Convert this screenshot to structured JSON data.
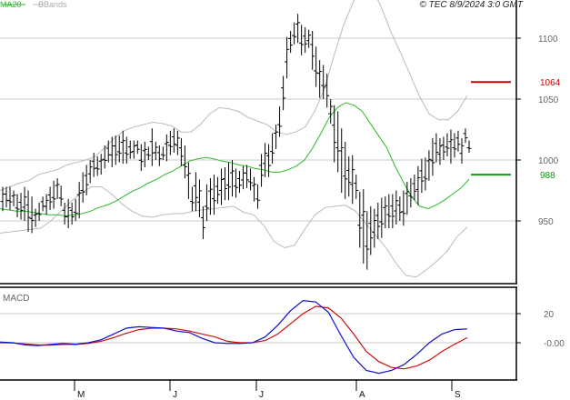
{
  "chart_data": [
    {
      "type": "line",
      "panel": "price",
      "header": "© TEC 8/9/2024 3:0 GMT",
      "legend": [
        {
          "name": "MA20",
          "color": "#2db82d"
        },
        {
          "name": "BBands",
          "color": "#bbbbbb"
        }
      ],
      "y_ticks": [
        950,
        1000,
        1050,
        1100
      ],
      "ylim": [
        900,
        1120
      ],
      "x_ticks": [
        "M",
        "J",
        "J",
        "A",
        "S"
      ],
      "annotations": [
        {
          "label": "1064",
          "value": 1064,
          "color": "#cc0000"
        },
        {
          "label": "988",
          "value": 988,
          "color": "#129912"
        }
      ],
      "series": [
        {
          "name": "Price (OHLC bars)",
          "color": "#000000",
          "highs": [
            978,
            978,
            978,
            975,
            972,
            973,
            978,
            975,
            970,
            960,
            965,
            970,
            972,
            978,
            983,
            985,
            979,
            965,
            968,
            965,
            968,
            982,
            990,
            996,
            1000,
            1006,
            1003,
            1005,
            1012,
            1016,
            1019,
            1020,
            1020,
            1024,
            1019,
            1016,
            1016,
            1016,
            1013,
            1015,
            1011,
            1026,
            1015,
            1012,
            1011,
            1021,
            1024,
            1026,
            1024,
            1018,
            1012,
            998,
            978,
            990,
            984,
            962,
            980,
            985,
            988,
            986,
            993,
            994,
            998,
            1000,
            993,
            991,
            995,
            996,
            993,
            986,
            980,
            1005,
            1014,
            1013,
            1022,
            1029,
            1044,
            1069,
            1101,
            1106,
            1113,
            1120,
            1111,
            1109,
            1107,
            1106,
            1093,
            1082,
            1078,
            1071,
            1050,
            1045,
            1040,
            1026,
            1015,
            1003,
            1004,
            988,
            974,
            976,
            958,
            962,
            960,
            965,
            969,
            970,
            972,
            972,
            975,
            970,
            975,
            982,
            985,
            988,
            995,
            1001,
            1002,
            1008,
            1018,
            1022,
            1018,
            1019,
            1022,
            1025,
            1022,
            1024,
            1018,
            1026,
            1016
          ],
          "lows": [
            958,
            961,
            959,
            962,
            953,
            951,
            950,
            941,
            940,
            945,
            950,
            958,
            955,
            959,
            960,
            968,
            962,
            947,
            944,
            947,
            950,
            952,
            965,
            971,
            981,
            986,
            987,
            988,
            993,
            998,
            994,
            996,
            998,
            997,
            997,
            1001,
            1001,
            1005,
            991,
            994,
            1000,
            995,
            1000,
            995,
            1000,
            999,
            1004,
            1006,
            1004,
            995,
            985,
            968,
            958,
            958,
            953,
            935,
            950,
            955,
            955,
            964,
            963,
            967,
            967,
            970,
            969,
            973,
            976,
            977,
            975,
            966,
            960,
            978,
            986,
            986,
            997,
            1009,
            1019,
            1041,
            1067,
            1088,
            1095,
            1096,
            1086,
            1088,
            1092,
            1074,
            1060,
            1051,
            1050,
            1043,
            1030,
            998,
            990,
            973,
            968,
            970,
            964,
            968,
            928,
            915,
            910,
            922,
            928,
            935,
            936,
            944,
            944,
            944,
            947,
            950,
            946,
            955,
            961,
            967,
            963,
            973,
            975,
            983,
            987,
            998,
            996,
            1000,
            1003,
            997,
            1002,
            1007,
            997,
            1014,
            1006
          ]
        },
        {
          "name": "MA20",
          "color": "#2db82d",
          "values": [
            960,
            959,
            958,
            958,
            957,
            956,
            955,
            955,
            954,
            955,
            956,
            958,
            961,
            963,
            966,
            970,
            974,
            977,
            981,
            984,
            988,
            991,
            995,
            999,
            1001,
            1002,
            1001,
            999,
            998,
            996,
            995,
            993,
            992,
            990,
            990,
            992,
            995,
            1000,
            1010,
            1022,
            1035,
            1043,
            1047,
            1045,
            1040,
            1030,
            1020,
            1010,
            995,
            982,
            970,
            962,
            960,
            963,
            967,
            972,
            977,
            984
          ]
        },
        {
          "name": "BB upper",
          "color": "#bbbbbb",
          "values": [
            975,
            978,
            981,
            983,
            988,
            990,
            992,
            996,
            998,
            1000,
            1003,
            1010,
            1018,
            1024,
            1027,
            1029,
            1031,
            1030,
            1028,
            1023,
            1023,
            1029,
            1038,
            1043,
            1042,
            1040,
            1035,
            1032,
            1029,
            1023,
            1021,
            1023,
            1027,
            1040,
            1058,
            1085,
            1110,
            1129,
            1145,
            1142,
            1125,
            1105,
            1088,
            1070,
            1052,
            1038,
            1033,
            1033,
            1040,
            1053
          ]
        },
        {
          "name": "BB lower",
          "color": "#bbbbbb",
          "values": [
            940,
            941,
            942,
            943,
            944,
            950,
            958,
            966,
            973,
            978,
            978,
            972,
            964,
            958,
            954,
            953,
            955,
            956,
            956,
            958,
            959,
            960,
            961,
            962,
            957,
            955,
            946,
            933,
            928,
            930,
            943,
            955,
            961,
            962,
            963,
            958,
            948,
            938,
            928,
            915,
            905,
            904,
            910,
            917,
            925,
            937,
            945
          ]
        }
      ]
    },
    {
      "type": "line",
      "panel": "macd",
      "title": "MACD",
      "y_ticks": [
        "-0.00",
        "20"
      ],
      "ylim": [
        -22,
        30
      ],
      "series": [
        {
          "name": "MACD",
          "color": "#1010cc",
          "values": [
            0.5,
            0,
            -1.5,
            -2,
            -1.2,
            -0.5,
            -1,
            0,
            2,
            6,
            10,
            11,
            10.5,
            10,
            8,
            7,
            3,
            0,
            -0.5,
            -0.5,
            0,
            4,
            12,
            22,
            29,
            28,
            21,
            5,
            -10,
            -19,
            -21,
            -19,
            -15,
            -8,
            0,
            6,
            9,
            9.5
          ]
        },
        {
          "name": "Signal",
          "color": "#cc1010",
          "values": [
            0,
            -0.2,
            -0.8,
            -1.5,
            -1.6,
            -1.2,
            -1.2,
            -0.5,
            1,
            3.5,
            6.5,
            9,
            10,
            10,
            9.5,
            8,
            6,
            4,
            1,
            0,
            0.1,
            1.5,
            6,
            13,
            20,
            25,
            24,
            17,
            6,
            -6,
            -13,
            -17,
            -18,
            -16,
            -12,
            -6,
            -1,
            3.5
          ]
        }
      ]
    }
  ]
}
